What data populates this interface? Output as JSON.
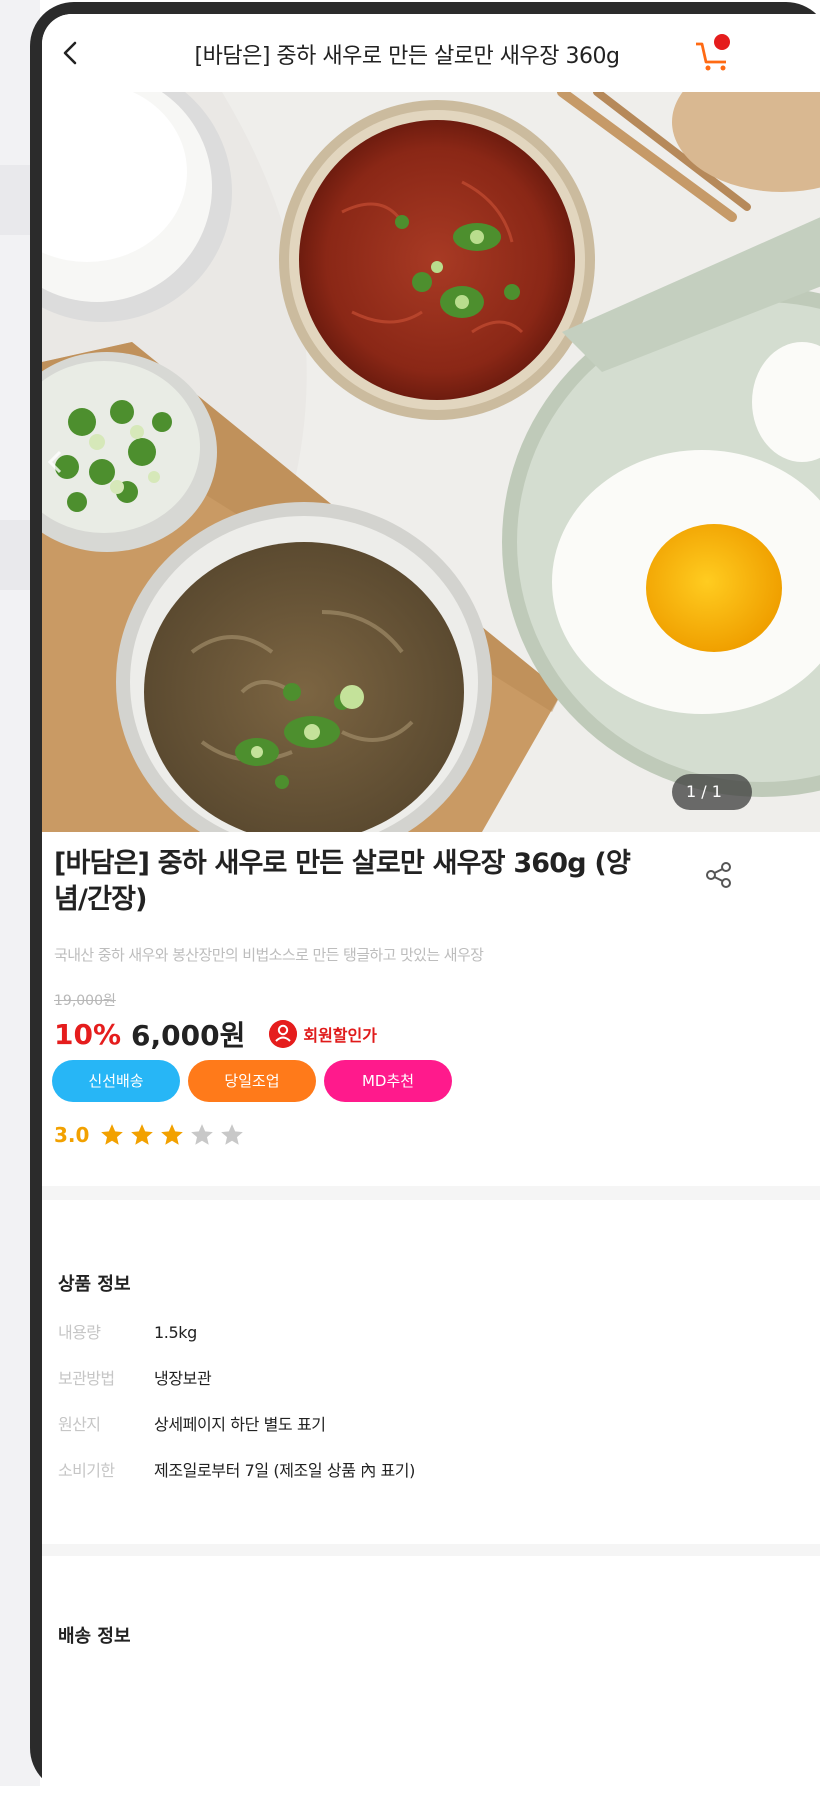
{
  "header": {
    "title": "[바담은] 중하 새우로 만든 살로만 새우장 360g"
  },
  "gallery": {
    "counter": "1 / 1"
  },
  "product": {
    "name": "[바담은] 중하 새우로 만든 살로만 새우장 360g (양념/간장)",
    "description": "국내산 중하 새우와 봉산장만의 비법소스로 만든 탱글하고 맛있는 새우장",
    "original_price": "19,000원",
    "discount_rate": "10%",
    "price": "6,000원",
    "member_label": "회원할인가",
    "badges": [
      {
        "label": "신선배송",
        "color": "#27b6f6"
      },
      {
        "label": "당일조업",
        "color": "#ff7a1a"
      },
      {
        "label": "MD추천",
        "color": "#ff1a8c"
      }
    ],
    "rating": 3.0,
    "rating_label": "3.0",
    "stars_filled": 3,
    "stars_total": 5
  },
  "product_info": {
    "title": "상품 정보",
    "rows": [
      {
        "key": "내용량",
        "value": "1.5kg"
      },
      {
        "key": "보관방법",
        "value": "냉장보관"
      },
      {
        "key": "원산지",
        "value": "상세페이지 하단 별도 표기"
      },
      {
        "key": "소비기한",
        "value": "제조일로부터 7일 (제조일 상품 內 표기)"
      }
    ]
  },
  "delivery_info": {
    "title": "배송 정보"
  },
  "colors": {
    "accent_red": "#e51d1d",
    "star_filled": "#f2a100",
    "star_empty": "#c8c8c8"
  }
}
